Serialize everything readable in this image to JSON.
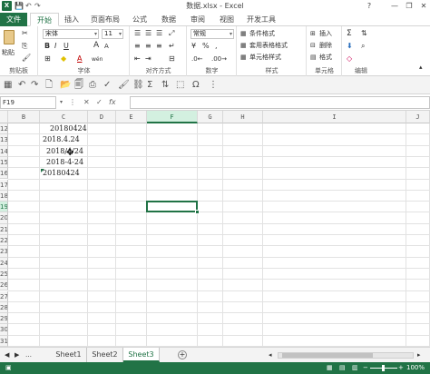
{
  "window": {
    "title": "数据.xlsx - Excel",
    "help": "?",
    "minimize": "—",
    "restore": "❐",
    "close": "✕"
  },
  "quick_access": {
    "save": "💾",
    "undo": "↶",
    "redo": "↷"
  },
  "tabs": [
    "文件",
    "开始",
    "插入",
    "页面布局",
    "公式",
    "数据",
    "审阅",
    "视图",
    "开发工具"
  ],
  "ribbon": {
    "clipboard": {
      "label": "剪贴板",
      "paste": "粘贴"
    },
    "font": {
      "label": "字体",
      "name": "宋体",
      "size": "11",
      "bold": "B",
      "italic": "I",
      "underline": "U",
      "grow": "A",
      "shrink": "A",
      "color_a": "A",
      "wen": "wén"
    },
    "alignment": {
      "label": "对齐方式"
    },
    "number": {
      "label": "数字",
      "format": "常规",
      "percent": "%",
      "comma": ","
    },
    "styles": {
      "label": "样式",
      "conditional": "条件格式",
      "table": "套用表格格式",
      "cell": "单元格样式"
    },
    "cells": {
      "label": "单元格",
      "insert": "插入",
      "delete": "删除",
      "format": "格式"
    },
    "editing": {
      "label": "编辑"
    }
  },
  "formula_bar": {
    "name_box": "F19",
    "fx": "fx",
    "cancel": "✕",
    "enter": "✓",
    "value": ""
  },
  "columns": [
    "B",
    "C",
    "D",
    "E",
    "F",
    "G",
    "H",
    "I",
    "J"
  ],
  "selected_column": "F",
  "rows": [
    "12",
    "13",
    "14",
    "15",
    "16",
    "17",
    "18",
    "19",
    "20",
    "21",
    "22",
    "23",
    "24",
    "25",
    "26",
    "27",
    "28",
    "29",
    "30",
    "31"
  ],
  "selected_row": "19",
  "cells": [
    {
      "ref": "C12",
      "text": "20180424"
    },
    {
      "ref": "C13",
      "text": "2018.4.24"
    },
    {
      "ref": "C14",
      "text": "2018/4/24"
    },
    {
      "ref": "C15",
      "text": "2018-4-24"
    },
    {
      "ref": "C16",
      "text": "20180424"
    }
  ],
  "sheets": [
    "Sheet1",
    "Sheet2",
    "Sheet3"
  ],
  "active_sheet": "Sheet3",
  "add_sheet": "+",
  "status": {
    "zoom": "100%",
    "minus": "−",
    "plus": "+"
  },
  "colors": {
    "accent": "#217346",
    "selection_fill": "#d3f0e0"
  }
}
